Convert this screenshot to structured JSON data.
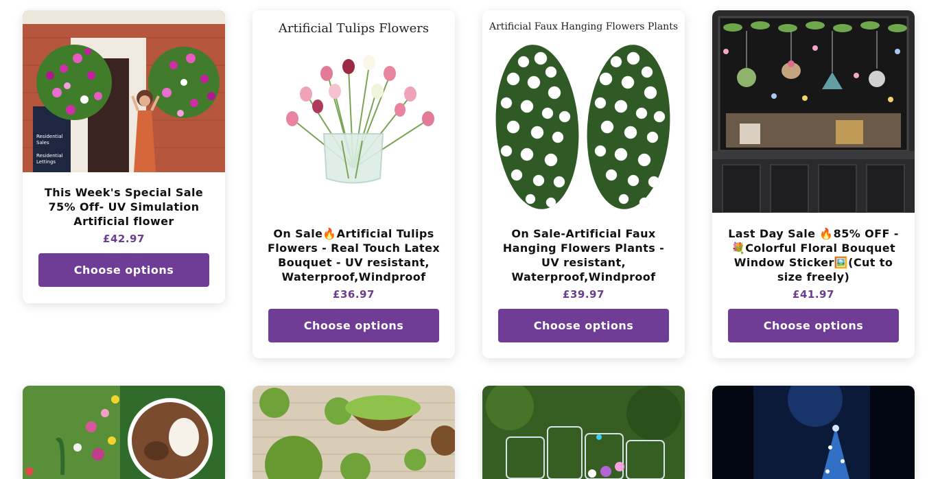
{
  "products": [
    {
      "title_lines": [
        "This Week's Special Sale",
        "75% Off- UV Simulation",
        "Artificial flower"
      ],
      "price": "£42.97",
      "button": "Choose options",
      "image_caption": "",
      "image_sign": [
        "Residential",
        "Sales",
        "Residential",
        "Lettings"
      ]
    },
    {
      "title_lines": [
        "On Sale🔥Artificial Tulips",
        "Flowers - Real Touch Latex",
        "Bouquet - UV resistant,",
        "Waterproof,Windproof"
      ],
      "price": "£36.97",
      "button": "Choose options",
      "image_caption": "Artificial Tulips Flowers"
    },
    {
      "title_lines": [
        "On Sale-Artificial Faux",
        "Hanging Flowers Plants -",
        "UV resistant,",
        "Waterproof,Windproof"
      ],
      "price": "£39.97",
      "button": "Choose options",
      "image_caption": "Artificial Faux Hanging Flowers Plants"
    },
    {
      "title_lines": [
        "Last Day Sale 🔥85% OFF -",
        "💐Colorful Floral Bouquet",
        "Window Sticker🖼️(Cut to",
        "size freely)"
      ],
      "price": "£41.97",
      "button": "Choose options",
      "image_caption": ""
    }
  ],
  "colors": {
    "button_bg": "#6f3d95",
    "price": "#6a3d8f"
  }
}
